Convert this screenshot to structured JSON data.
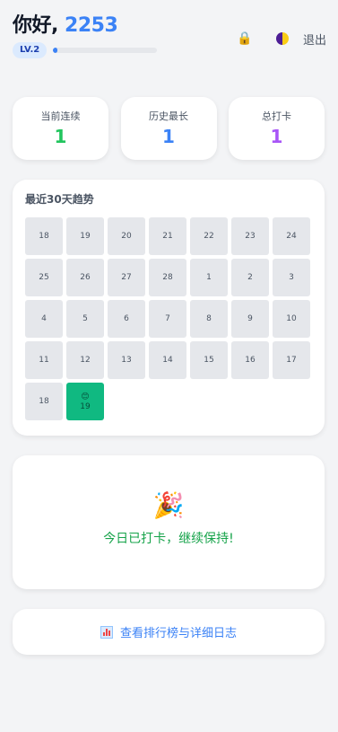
{
  "header": {
    "greeting_prefix": "你好,",
    "user_id": "2253",
    "level": "LV.2",
    "level_progress": 0.04,
    "lock_icon": "lock-icon",
    "theme_icon": "moon-icon",
    "logout_label": "退出"
  },
  "stats": [
    {
      "label": "当前连续",
      "value": "1",
      "color": "#22c55e"
    },
    {
      "label": "历史最长",
      "value": "1",
      "color": "#3b82f6"
    },
    {
      "label": "总打卡",
      "value": "1",
      "color": "#a855f7"
    }
  ],
  "trend": {
    "title": "最近30天趋势",
    "days": [
      "18",
      "19",
      "20",
      "21",
      "22",
      "23",
      "24",
      "25",
      "26",
      "27",
      "28",
      "1",
      "2",
      "3",
      "4",
      "5",
      "6",
      "7",
      "8",
      "9",
      "10",
      "11",
      "12",
      "13",
      "14",
      "15",
      "16",
      "17",
      "18",
      "19"
    ],
    "checked_index": 29,
    "checked_emoji": "😊",
    "checked_color": "#10b981"
  },
  "status": {
    "icon": "🎉",
    "text": "今日已打卡，继续保持!"
  },
  "link": {
    "label": "查看排行榜与详细日志"
  }
}
